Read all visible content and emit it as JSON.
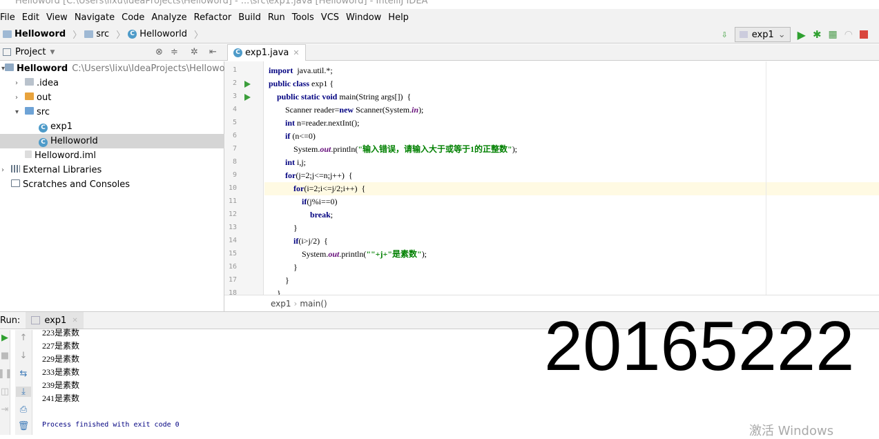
{
  "window_title": "Helloword [C:\\Users\\lixu\\IdeaProjects\\Helloword] - ...\\src\\exp1.java [Helloword] - IntelliJ IDEA",
  "menu": [
    "File",
    "Edit",
    "View",
    "Navigate",
    "Code",
    "Analyze",
    "Refactor",
    "Build",
    "Run",
    "Tools",
    "VCS",
    "Window",
    "Help"
  ],
  "breadcrumb": [
    "Helloword",
    "src",
    "Helloworld"
  ],
  "run_config": "exp1",
  "project_panel": {
    "title": "Project",
    "items": [
      {
        "label": "Helloword",
        "path": "C:\\Users\\lixu\\IdeaProjects\\Helloword",
        "icon": "module-icon"
      },
      {
        "label": ".idea",
        "icon": "folder-icon"
      },
      {
        "label": "out",
        "icon": "folder-orange-icon"
      },
      {
        "label": "src",
        "icon": "folder-blue-icon"
      },
      {
        "label": "exp1",
        "icon": "class-icon"
      },
      {
        "label": "Helloworld",
        "icon": "class-icon",
        "selected": true
      },
      {
        "label": "Helloword.iml",
        "icon": "iml-icon"
      },
      {
        "label": "External Libraries",
        "icon": "library-icon"
      },
      {
        "label": "Scratches and Consoles",
        "icon": "scratch-icon"
      }
    ]
  },
  "editor": {
    "tab": "exp1.java",
    "current_line": 10,
    "lines": [
      [
        [
          "kw",
          "import"
        ],
        [
          "",
          "  java.util.*;"
        ]
      ],
      [
        [
          "kw",
          "public class"
        ],
        [
          "",
          " exp1 {"
        ]
      ],
      [
        [
          "",
          "    "
        ],
        [
          "kw",
          "public static void"
        ],
        [
          "",
          " main(String args[])  {"
        ]
      ],
      [
        [
          "",
          "        Scanner reader="
        ],
        [
          "kw",
          "new"
        ],
        [
          "",
          " Scanner(System."
        ],
        [
          "fld",
          "in"
        ],
        [
          "",
          ");"
        ]
      ],
      [
        [
          "",
          "        "
        ],
        [
          "kw",
          "int"
        ],
        [
          "",
          " n=reader.nextInt();"
        ]
      ],
      [
        [
          "",
          "        "
        ],
        [
          "kw",
          "if"
        ],
        [
          "",
          " (n<=0)"
        ]
      ],
      [
        [
          "",
          "            System."
        ],
        [
          "fld",
          "out"
        ],
        [
          "",
          ".println("
        ],
        [
          "str",
          "\"输入错误，请输入大于或等于1的正整数\""
        ],
        [
          "",
          ");"
        ]
      ],
      [
        [
          "",
          "        "
        ],
        [
          "kw",
          "int"
        ],
        [
          "",
          " i,j;"
        ]
      ],
      [
        [
          "",
          "        "
        ],
        [
          "kw",
          "for"
        ],
        [
          "",
          "(j=2;j<=n;j++)  {"
        ]
      ],
      [
        [
          "",
          "            "
        ],
        [
          "kw",
          "for"
        ],
        [
          "",
          "(i=2;i<=j/2;i++)  {"
        ]
      ],
      [
        [
          "",
          "                "
        ],
        [
          "kw",
          "if"
        ],
        [
          "",
          "(j%i==0)"
        ]
      ],
      [
        [
          "",
          "                    "
        ],
        [
          "kw",
          "break"
        ],
        [
          "",
          ";"
        ]
      ],
      [
        [
          "",
          "            }"
        ]
      ],
      [
        [
          "",
          "            "
        ],
        [
          "kw",
          "if"
        ],
        [
          "",
          "(i>j/2)  {"
        ]
      ],
      [
        [
          "",
          "                System."
        ],
        [
          "fld",
          "out"
        ],
        [
          "",
          ".println("
        ],
        [
          "str",
          "\"\"+j+\"是素数\""
        ],
        [
          "",
          ");"
        ]
      ],
      [
        [
          "",
          "            }"
        ]
      ],
      [
        [
          "",
          "        }"
        ]
      ],
      [
        [
          "",
          "    }"
        ]
      ],
      [
        [
          "",
          "}"
        ]
      ]
    ],
    "footer": [
      "exp1",
      "main()"
    ]
  },
  "run": {
    "label": "Run:",
    "tab": "exp1",
    "output": [
      "223是素数",
      "227是素数",
      "229是素数",
      "233是素数",
      "239是素数",
      "241是素数",
      "",
      "Process finished with exit code 0"
    ]
  },
  "overlay_number": "20165222",
  "watermark": "激活 Windows"
}
